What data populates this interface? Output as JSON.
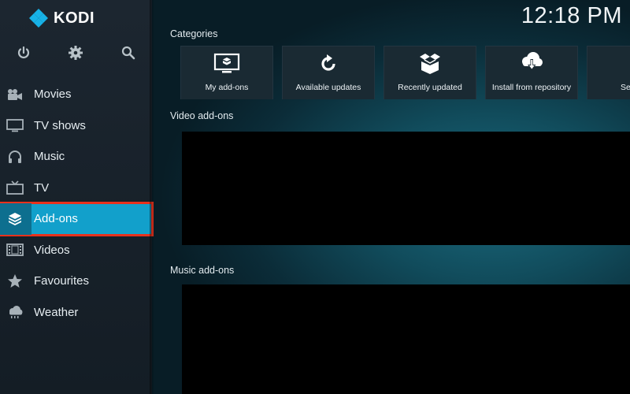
{
  "app": {
    "name": "KODI",
    "clock": "12:18 PM"
  },
  "toolbar": [
    {
      "icon": "power-icon"
    },
    {
      "icon": "gear-icon"
    },
    {
      "icon": "search-icon"
    }
  ],
  "sidebar": {
    "items": [
      {
        "label": "Movies",
        "icon": "movie-camera-icon"
      },
      {
        "label": "TV shows",
        "icon": "monitor-icon"
      },
      {
        "label": "Music",
        "icon": "headphones-icon"
      },
      {
        "label": "TV",
        "icon": "tv-icon"
      },
      {
        "label": "Add-ons",
        "icon": "addon-box-icon",
        "selected": true
      },
      {
        "label": "Videos",
        "icon": "film-strip-icon"
      },
      {
        "label": "Favourites",
        "icon": "star-icon"
      },
      {
        "label": "Weather",
        "icon": "weather-cloud-icon"
      }
    ]
  },
  "main": {
    "categories_title": "Categories",
    "categories": [
      {
        "label": "My add-ons",
        "icon": "my-addons-icon"
      },
      {
        "label": "Available updates",
        "icon": "refresh-icon"
      },
      {
        "label": "Recently updated",
        "icon": "open-box-icon"
      },
      {
        "label": "Install from repository",
        "icon": "cloud-download-icon"
      },
      {
        "label": "Se",
        "icon": "search-icon"
      }
    ],
    "video_addons_title": "Video add-ons",
    "music_addons_title": "Music add-ons"
  },
  "colors": {
    "accent": "#12a0cb",
    "highlight_border": "#e8311c",
    "sidebar_bg": "#1c2630"
  }
}
